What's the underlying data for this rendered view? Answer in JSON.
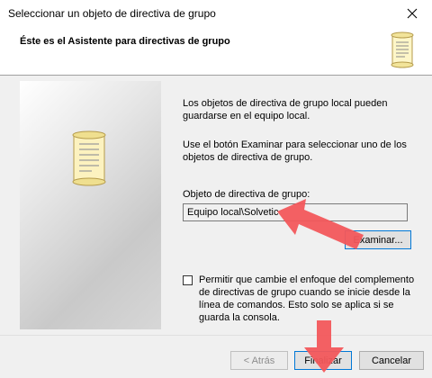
{
  "window": {
    "title": "Seleccionar un objeto de directiva de grupo"
  },
  "header": {
    "title": "Éste es el Asistente para directivas de grupo",
    "icon": "scroll-icon"
  },
  "content": {
    "paragraph1": "Los objetos de directiva de grupo local pueden guardarse en el equipo local.",
    "paragraph2": "Use el botón Examinar para seleccionar uno de los objetos de directiva de grupo.",
    "gpo_label": "Objeto de directiva de grupo:",
    "gpo_value": "Equipo local\\Solvetic",
    "examine_label": "Examinar...",
    "checkbox_label": "Permitir que cambie el enfoque del complemento de directivas de grupo cuando se inicie desde la línea de comandos. Esto solo se aplica si se guarda la consola."
  },
  "footer": {
    "back_label": "< Atrás",
    "finish_label": "Finalizar",
    "cancel_label": "Cancelar"
  },
  "colors": {
    "annotation_arrow": "#f2575b",
    "focus_border": "#0078d7"
  }
}
